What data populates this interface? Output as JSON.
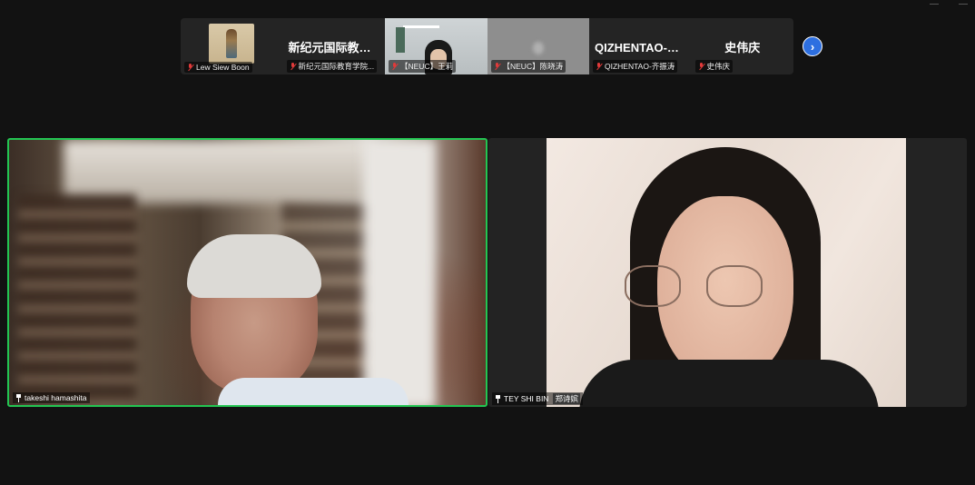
{
  "filmstrip": {
    "participants": [
      {
        "tag": "Lew Siew Boon",
        "muted": true
      },
      {
        "display": "新纪元国际教育...",
        "tag": "新纪元国际教育学院...",
        "muted": true
      },
      {
        "tag": "【NEUC】王莉",
        "muted": true
      },
      {
        "tag": "【NEUC】陈晓涛",
        "muted": true
      },
      {
        "display": "QIZHENTAO-齐...",
        "tag": "QIZHENTAO-齐振涛",
        "muted": true
      },
      {
        "display": "史伟庆",
        "tag": "史伟庆",
        "muted": true
      }
    ],
    "next_label": "›"
  },
  "tiles": {
    "left": {
      "name": "takeshi hamashita",
      "active_speaker": true
    },
    "right": {
      "name": "TEY SHI BIN",
      "subname": "郑诗嫔"
    }
  },
  "colors": {
    "active_border": "#23c552",
    "accent": "#2d6fe0",
    "muted_mic": "#e03a3a"
  }
}
